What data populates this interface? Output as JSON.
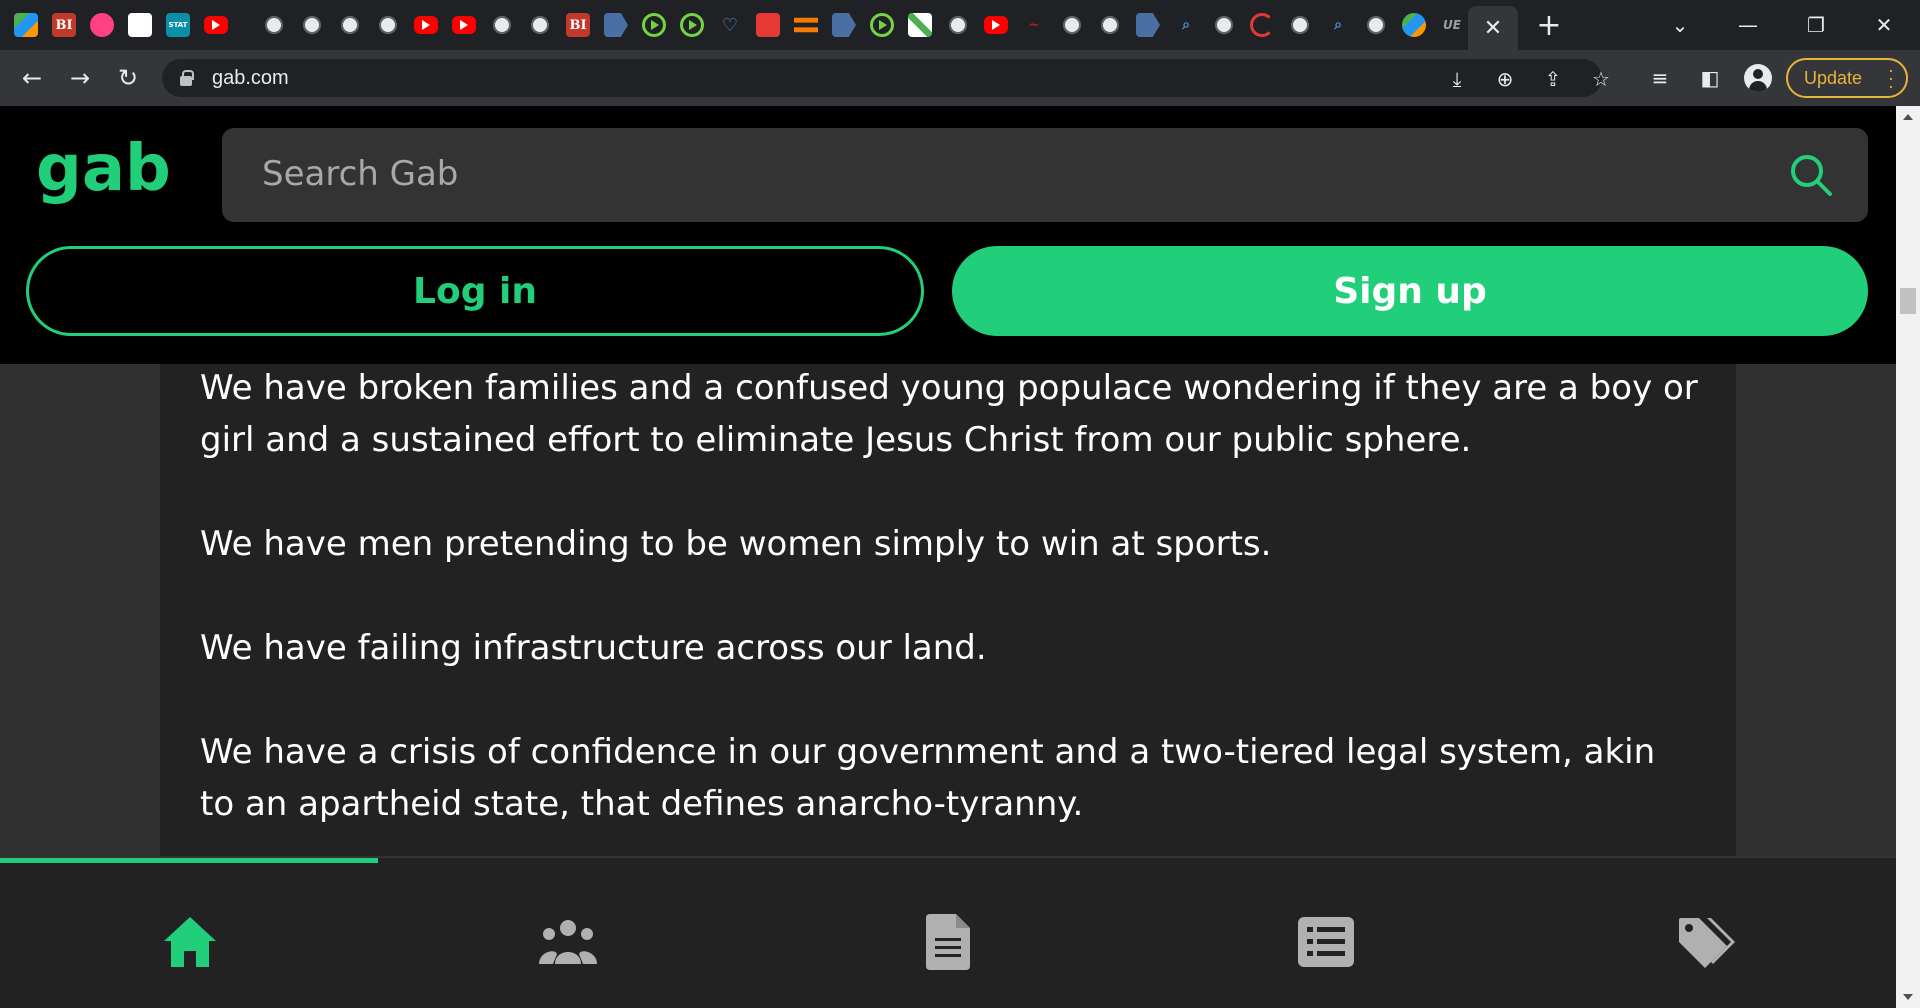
{
  "browser": {
    "url": "gab.com",
    "update_label": "Update",
    "tab_favicons": [
      "globe-icon",
      "business-insider-icon",
      "pinwheel-icon",
      "blank-icon",
      "stat-icon",
      "youtube-icon",
      "globe-icon",
      "globe-icon",
      "globe-icon",
      "globe-icon",
      "youtube-icon",
      "youtube-icon",
      "globe-icon",
      "globe-icon",
      "business-insider-icon",
      "arrow-icon",
      "rumble-icon",
      "rumble-icon",
      "heart-icon",
      "mic-icon",
      "orange-menu-icon",
      "arrow-icon",
      "rumble-icon",
      "multicolor-icon",
      "globe-icon",
      "youtube-icon",
      "pink-icon",
      "globe-icon",
      "globe-icon",
      "arrow-icon",
      "search-icon",
      "globe-icon",
      "red-c-icon",
      "globe-icon",
      "search-icon",
      "globe-icon",
      "shield-icon",
      "text-icon"
    ],
    "stat_label": "STAT",
    "bi_label": "BI"
  },
  "gab": {
    "logo_text": "gab",
    "search_placeholder": "Search Gab",
    "login_label": "Log in",
    "signup_label": "Sign up",
    "brand_color": "#21cf7b"
  },
  "post": {
    "paragraphs": [
      "We have broken families and a confused young populace wondering if they are a boy or girl and a sustained effort to eliminate Jesus Christ from our public sphere.",
      "We have men pretending to be women simply to win at sports.",
      "We have failing infrastructure across our land.",
      "We have a crisis of confidence in our government and a two-tiered legal system, akin to an apartheid state, that defines anarcho-tyranny."
    ]
  },
  "bottom_nav": {
    "items": [
      "home-icon",
      "groups-icon",
      "news-icon",
      "lists-icon",
      "marketplace-icon"
    ],
    "active": "home-icon"
  }
}
